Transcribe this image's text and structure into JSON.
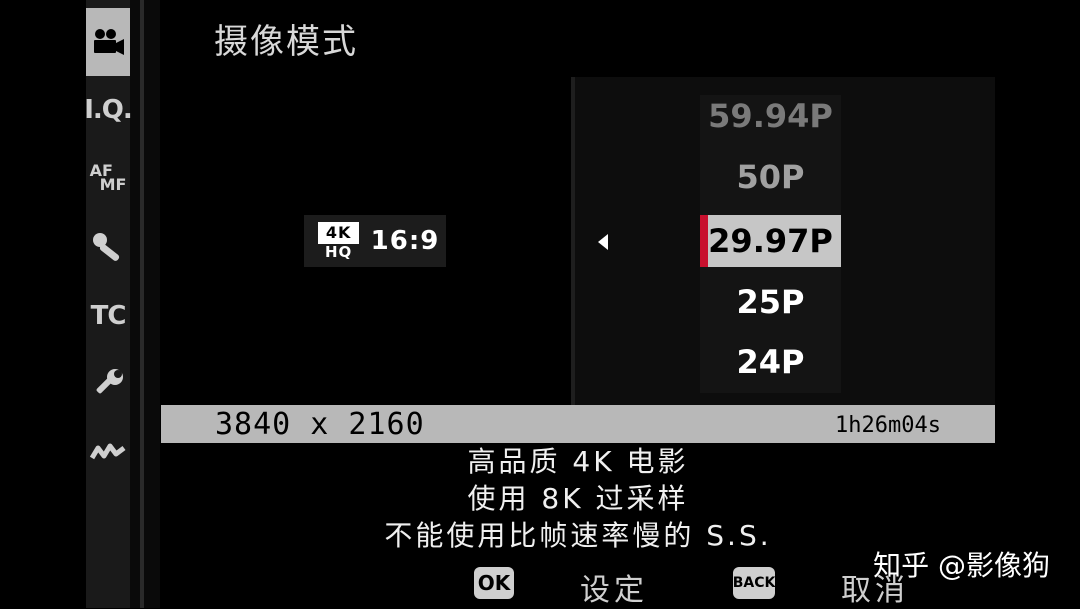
{
  "header": {
    "title": "摄像模式"
  },
  "sidebar": {
    "items": [
      {
        "label": "",
        "icon": "movie-camera-icon",
        "active": true
      },
      {
        "label": "I.Q.",
        "icon": "image-quality-icon",
        "active": false
      },
      {
        "label": "AF MF",
        "icon": "af-mf-icon",
        "active": false
      },
      {
        "label": "",
        "icon": "microphone-icon",
        "active": false
      },
      {
        "label": "TC",
        "icon": "timecode-icon",
        "active": false
      },
      {
        "label": "",
        "icon": "wrench-icon",
        "active": false
      },
      {
        "label": "",
        "icon": "connection-icon",
        "active": false
      }
    ]
  },
  "format": {
    "badge_top": "4K",
    "badge_bottom": "HQ",
    "aspect": "16:9"
  },
  "frame_rates": [
    {
      "label": "59.94P",
      "color": "#7a7a7a",
      "selected": false
    },
    {
      "label": "50P",
      "color": "#a0a0a0",
      "selected": false
    },
    {
      "label": "29.97P",
      "color": "#000000",
      "selected": true
    },
    {
      "label": "25P",
      "color": "#ffffff",
      "selected": false
    },
    {
      "label": "24P",
      "color": "#ffffff",
      "selected": false
    }
  ],
  "info": {
    "resolution": "3840 x 2160",
    "remaining_time": "1h26m04s"
  },
  "description": {
    "lines": [
      "高品质 4K 电影",
      "使用 8K 过采样",
      "不能使用比帧速率慢的 S.S."
    ]
  },
  "footer": {
    "ok_key": "OK",
    "ok_label": "设定",
    "back_key": "BACK",
    "back_label": "取消"
  },
  "watermark": "知乎 @影像狗",
  "colors": {
    "accent": "#c8102e",
    "selection": "#c6c6c6",
    "info_bar": "#b8b8b8"
  }
}
